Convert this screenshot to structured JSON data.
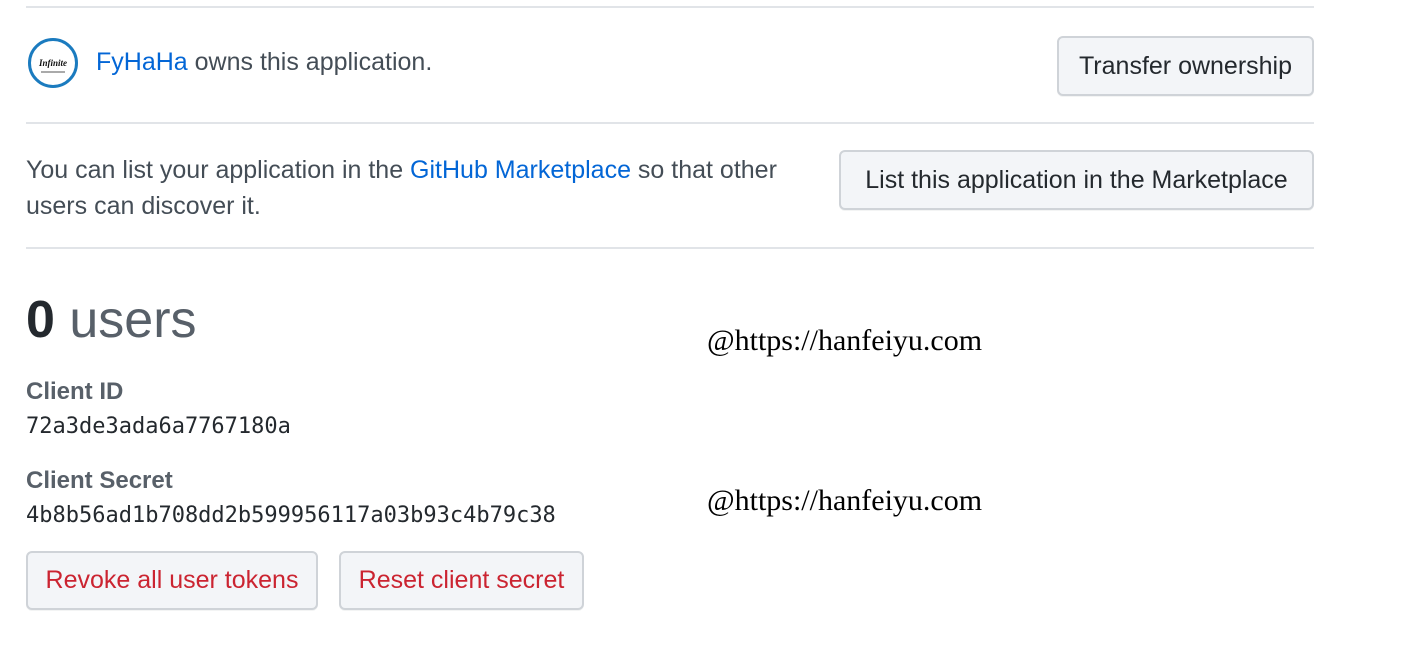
{
  "owner": {
    "avatar_icon": "owner-avatar-logo",
    "name": "FyHaHa",
    "suffix": " owns this application.",
    "transfer_button": "Transfer ownership"
  },
  "marketplace": {
    "text_before": "You can list your application in the ",
    "link": "GitHub Marketplace",
    "text_after": " so that other users can discover it.",
    "button": "List this application in the Marketplace"
  },
  "users": {
    "count": "0",
    "label": "users"
  },
  "client": {
    "id_label": "Client ID",
    "id_value": "72a3de3ada6a7767180a",
    "secret_label": "Client Secret",
    "secret_value": "4b8b56ad1b708dd2b599956117a03b93c4b79c38"
  },
  "actions": {
    "revoke_button": "Revoke all user tokens",
    "reset_button": "Reset client secret"
  },
  "watermark": {
    "text_1": "@https://hanfeiyu.com",
    "text_2": "@https://hanfeiyu.com"
  },
  "colors": {
    "link": "#0366d6",
    "danger": "#cb2431",
    "avatar_ring": "#1b7bbf",
    "divider": "#e1e4e8"
  }
}
